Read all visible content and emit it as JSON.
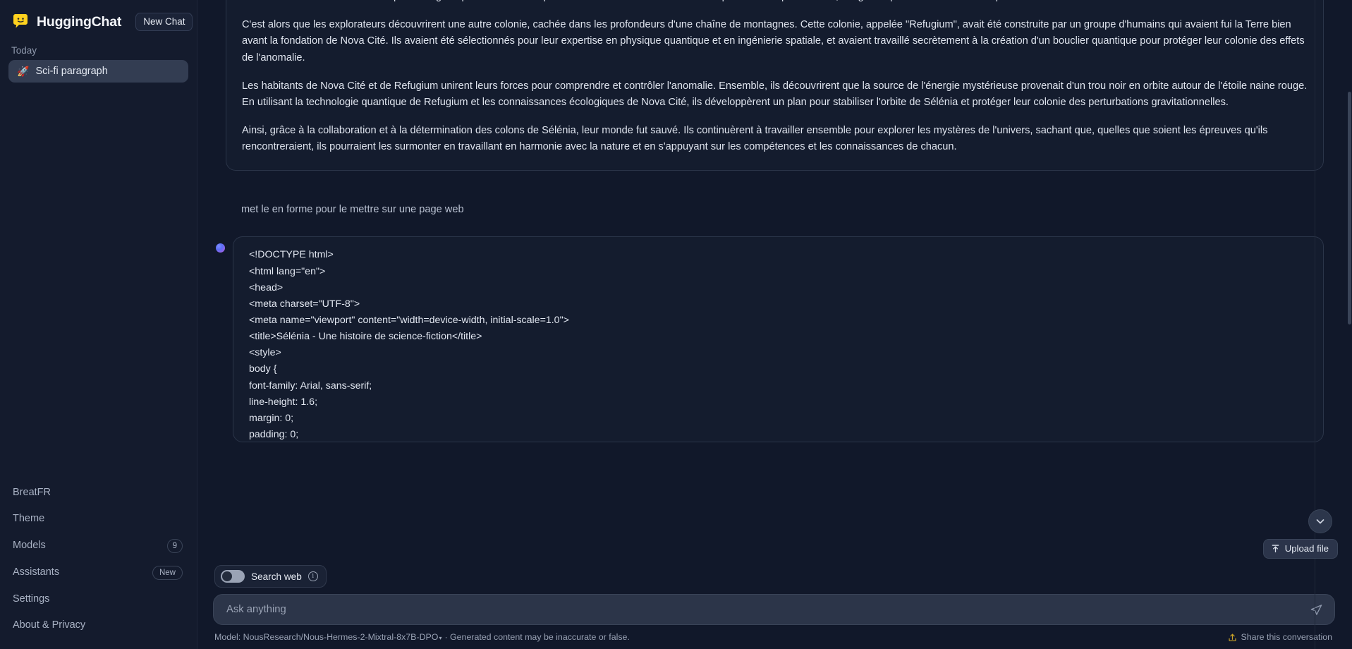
{
  "app": {
    "brand": "HuggingChat",
    "new_chat_label": "New Chat",
    "logo_icon": "speech-bubble-smile-icon"
  },
  "sidebar": {
    "section_label": "Today",
    "conversations": [
      {
        "emoji": "🚀",
        "title": "Sci-fi paragraph"
      }
    ],
    "footer_links": [
      {
        "label": "BreatFR",
        "badge": ""
      },
      {
        "label": "Theme",
        "badge": ""
      },
      {
        "label": "Models",
        "badge": "9",
        "badge_type": "count"
      },
      {
        "label": "Assistants",
        "badge": "New",
        "badge_type": "new"
      },
      {
        "label": "Settings",
        "badge": ""
      },
      {
        "label": "About & Privacy",
        "badge": ""
      }
    ]
  },
  "conversation": {
    "assistant_message_top": {
      "paragraphs": [
        "tremblements de terre et des tempêtes magnétiques. Les scientifiques de Nova Cité commencèrent à enquêter sur ce phénomène, craignant que cela ne menace l'équilibre délicat de leur nouvelle maison.",
        "C'est alors que les explorateurs découvrirent une autre colonie, cachée dans les profondeurs d'une chaîne de montagnes. Cette colonie, appelée \"Refugium\", avait été construite par un groupe d'humains qui avaient fui la Terre bien avant la fondation de Nova Cité. Ils avaient été sélectionnés pour leur expertise en physique quantique et en ingénierie spatiale, et avaient travaillé secrètement à la création d'un bouclier quantique pour protéger leur colonie des effets de l'anomalie.",
        "Les habitants de Nova Cité et de Refugium unirent leurs forces pour comprendre et contrôler l'anomalie. Ensemble, ils découvrirent que la source de l'énergie mystérieuse provenait d'un trou noir en orbite autour de l'étoile naine rouge. En utilisant la technologie quantique de Refugium et les connaissances écologiques de Nova Cité, ils développèrent un plan pour stabiliser l'orbite de Sélénia et protéger leur colonie des perturbations gravitationnelles.",
        "Ainsi, grâce à la collaboration et à la détermination des colons de Sélénia, leur monde fut sauvé. Ils continuèrent à travailler ensemble pour explorer les mystères de l'univers, sachant que, quelles que soient les épreuves qu'ils rencontreraient, ils pourraient les surmonter en travaillant en harmonie avec la nature et en s'appuyant sur les compétences et les connaissances de chacun."
      ]
    },
    "user_message": "met le en forme pour le mettre sur une page web",
    "assistant_message_code": {
      "lines": [
        "<!DOCTYPE html>",
        "<html lang=\"en\">",
        "<head>",
        "<meta charset=\"UTF-8\">",
        "<meta name=\"viewport\" content=\"width=device-width, initial-scale=1.0\">",
        "<title>Sélénia - Une histoire de science-fiction</title>",
        "<style>",
        "body {",
        "font-family: Arial, sans-serif;",
        "line-height: 1.6;",
        "margin: 0;",
        "padding: 0;",
        "}"
      ]
    }
  },
  "composer": {
    "search_web_label": "Search web",
    "search_web_enabled": false,
    "info_icon": "info-circle-icon",
    "input_placeholder": "Ask anything",
    "input_value": "",
    "send_icon": "send-paper-plane-icon",
    "scroll_down_icon": "chevron-down-icon",
    "upload_label": "Upload file",
    "upload_icon": "upload-arrow-icon"
  },
  "footer": {
    "model_note": "Model: NousResearch/Nous-Hermes-2-Mixtral-8x7B-DPO",
    "model_caret": "▾",
    "disclaimer": "· Generated content may be inaccurate or false.",
    "share_label": "Share this conversation",
    "share_icon": "share-upload-icon"
  },
  "colors": {
    "sidebar_bg": "#141b2d",
    "main_bg": "#11182a",
    "bubble_bg": "#141c2e",
    "bubble_border": "#2b3549",
    "accent_badge": "#3a4458",
    "active_conv": "#333d52",
    "share_icon_color": "#c9a227"
  }
}
